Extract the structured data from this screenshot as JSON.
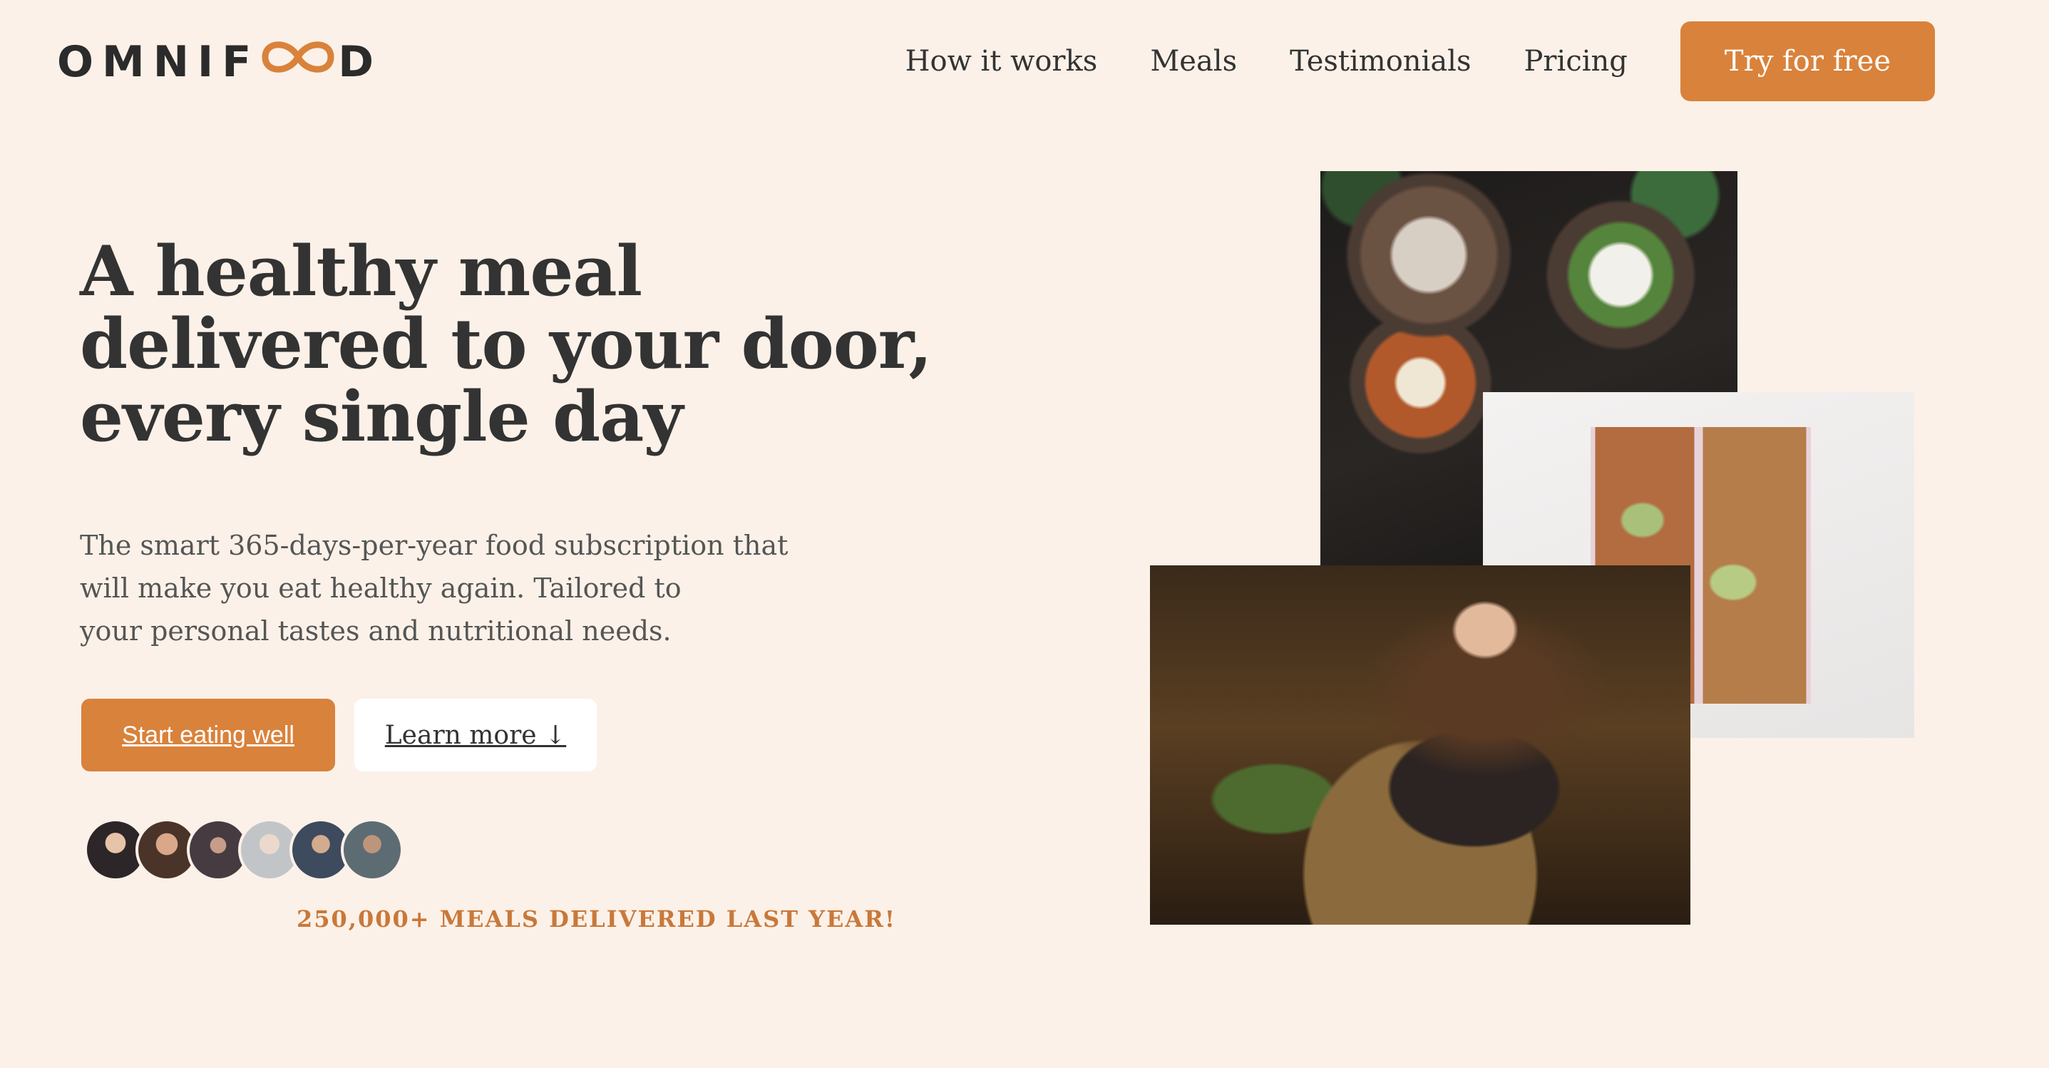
{
  "header": {
    "logo_text_left": "OMNIF",
    "logo_text_right": "D",
    "logo_icon": "infinity-icon",
    "nav": [
      "How it works",
      "Meals",
      "Testimonials",
      "Pricing"
    ],
    "cta_label": "Try for free"
  },
  "hero": {
    "headline_lines": [
      "A healthy meal",
      "delivered to your door,",
      "every single day"
    ],
    "description_lines": [
      "The smart 365-days-per-year food subscription that",
      "will make you eat healthy again. Tailored to",
      "your personal tastes and nutritional needs."
    ],
    "primary_button": "Start eating well",
    "secondary_button": "Learn more ↓",
    "delivered_text": "250,000+ MEALS DELIVERED LAST YEAR!"
  },
  "colors": {
    "background": "#fbf1e8",
    "accent": "#d9823b",
    "text": "#333333"
  }
}
